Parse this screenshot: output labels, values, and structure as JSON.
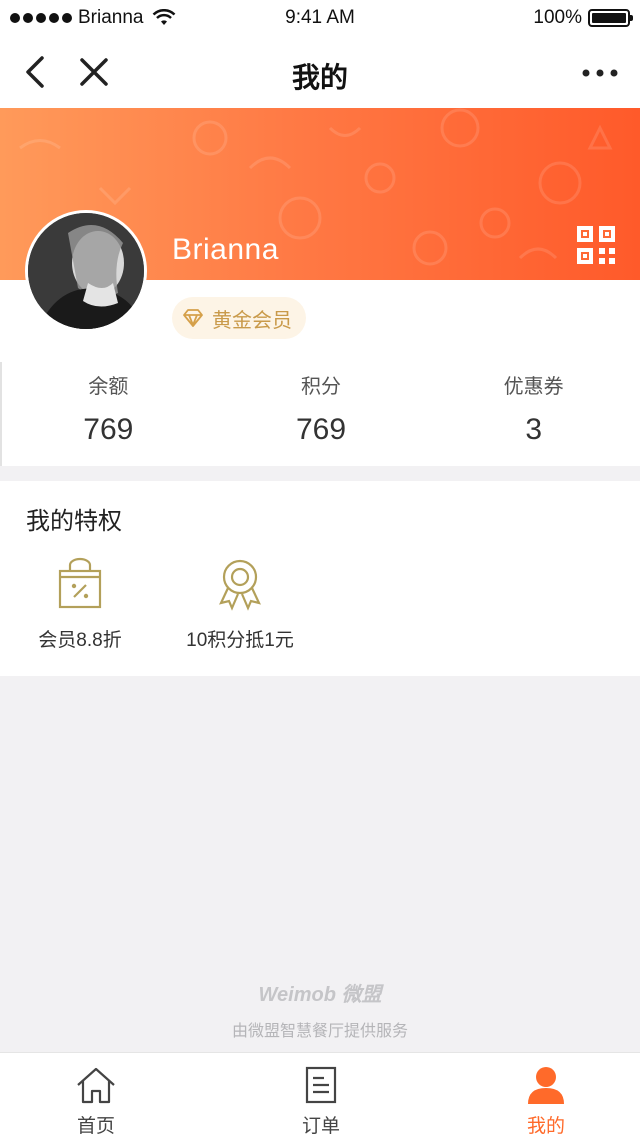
{
  "status_bar": {
    "carrier": "Brianna",
    "time": "9:41 AM",
    "battery": "100%"
  },
  "nav": {
    "title": "我的"
  },
  "profile": {
    "username": "Brianna",
    "member_level": "黄金会员"
  },
  "stats": [
    {
      "label": "余额",
      "value": "769"
    },
    {
      "label": "积分",
      "value": "769"
    },
    {
      "label": "优惠券",
      "value": "3"
    }
  ],
  "privileges": {
    "title": "我的特权",
    "items": [
      {
        "label": "会员8.8折",
        "icon": "discount-bag-icon"
      },
      {
        "label": "10积分抵1元",
        "icon": "award-ribbon-icon"
      }
    ]
  },
  "footer": {
    "brand_logo": "Weimob 微盟",
    "brand_text": "由微盟智慧餐厅提供服务"
  },
  "tabs": [
    {
      "label": "首页",
      "icon": "home-icon",
      "active": false
    },
    {
      "label": "订单",
      "icon": "order-list-icon",
      "active": false
    },
    {
      "label": "我的",
      "icon": "user-icon",
      "active": true
    }
  ],
  "colors": {
    "accent": "#ff6a2a",
    "banner_start": "#ff9a5a",
    "banner_end": "#ff5a2a",
    "gold": "#c99a4a",
    "privilege_icon": "#b3a05a"
  }
}
